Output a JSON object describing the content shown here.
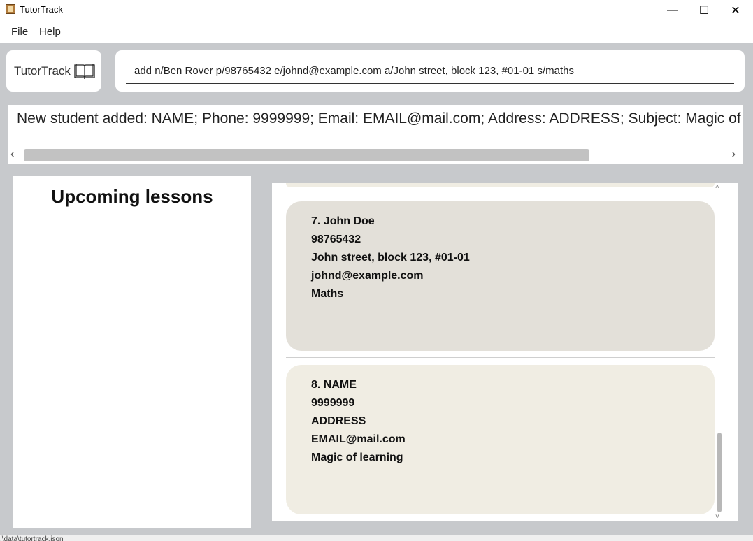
{
  "window": {
    "title": "TutorTrack",
    "minimize_glyph": "—",
    "maximize_glyph": "☐",
    "close_glyph": "✕"
  },
  "menu": {
    "file": "File",
    "help": "Help"
  },
  "brand": {
    "label": "TutorTrack",
    "icon": "open-book-icon"
  },
  "command": {
    "value": "add n/Ben Rover p/98765432 e/johnd@example.com a/John street, block 123, #01-01 s/maths"
  },
  "result": {
    "text": "New student added: NAME; Phone: 9999999; Email: EMAIL@mail.com; Address: ADDRESS; Subject: Magic of learning"
  },
  "lessons": {
    "title": "Upcoming lessons"
  },
  "students": [
    {
      "index_name": "7.  John Doe",
      "phone": "98765432",
      "address": "John street, block 123, #01-01",
      "email": "johnd@example.com",
      "subject": "Maths",
      "color": "#e3e0d9"
    },
    {
      "index_name": "8.  NAME",
      "phone": "9999999",
      "address": "ADDRESS",
      "email": "EMAIL@mail.com",
      "subject": "Magic of learning",
      "color": "#f0ede3"
    }
  ],
  "status": {
    "path": ".\\data\\tutortrack.json"
  },
  "colors": {
    "background": "#c7c9cc",
    "card_1": "#e3e0d9",
    "card_2": "#f0ede3"
  }
}
